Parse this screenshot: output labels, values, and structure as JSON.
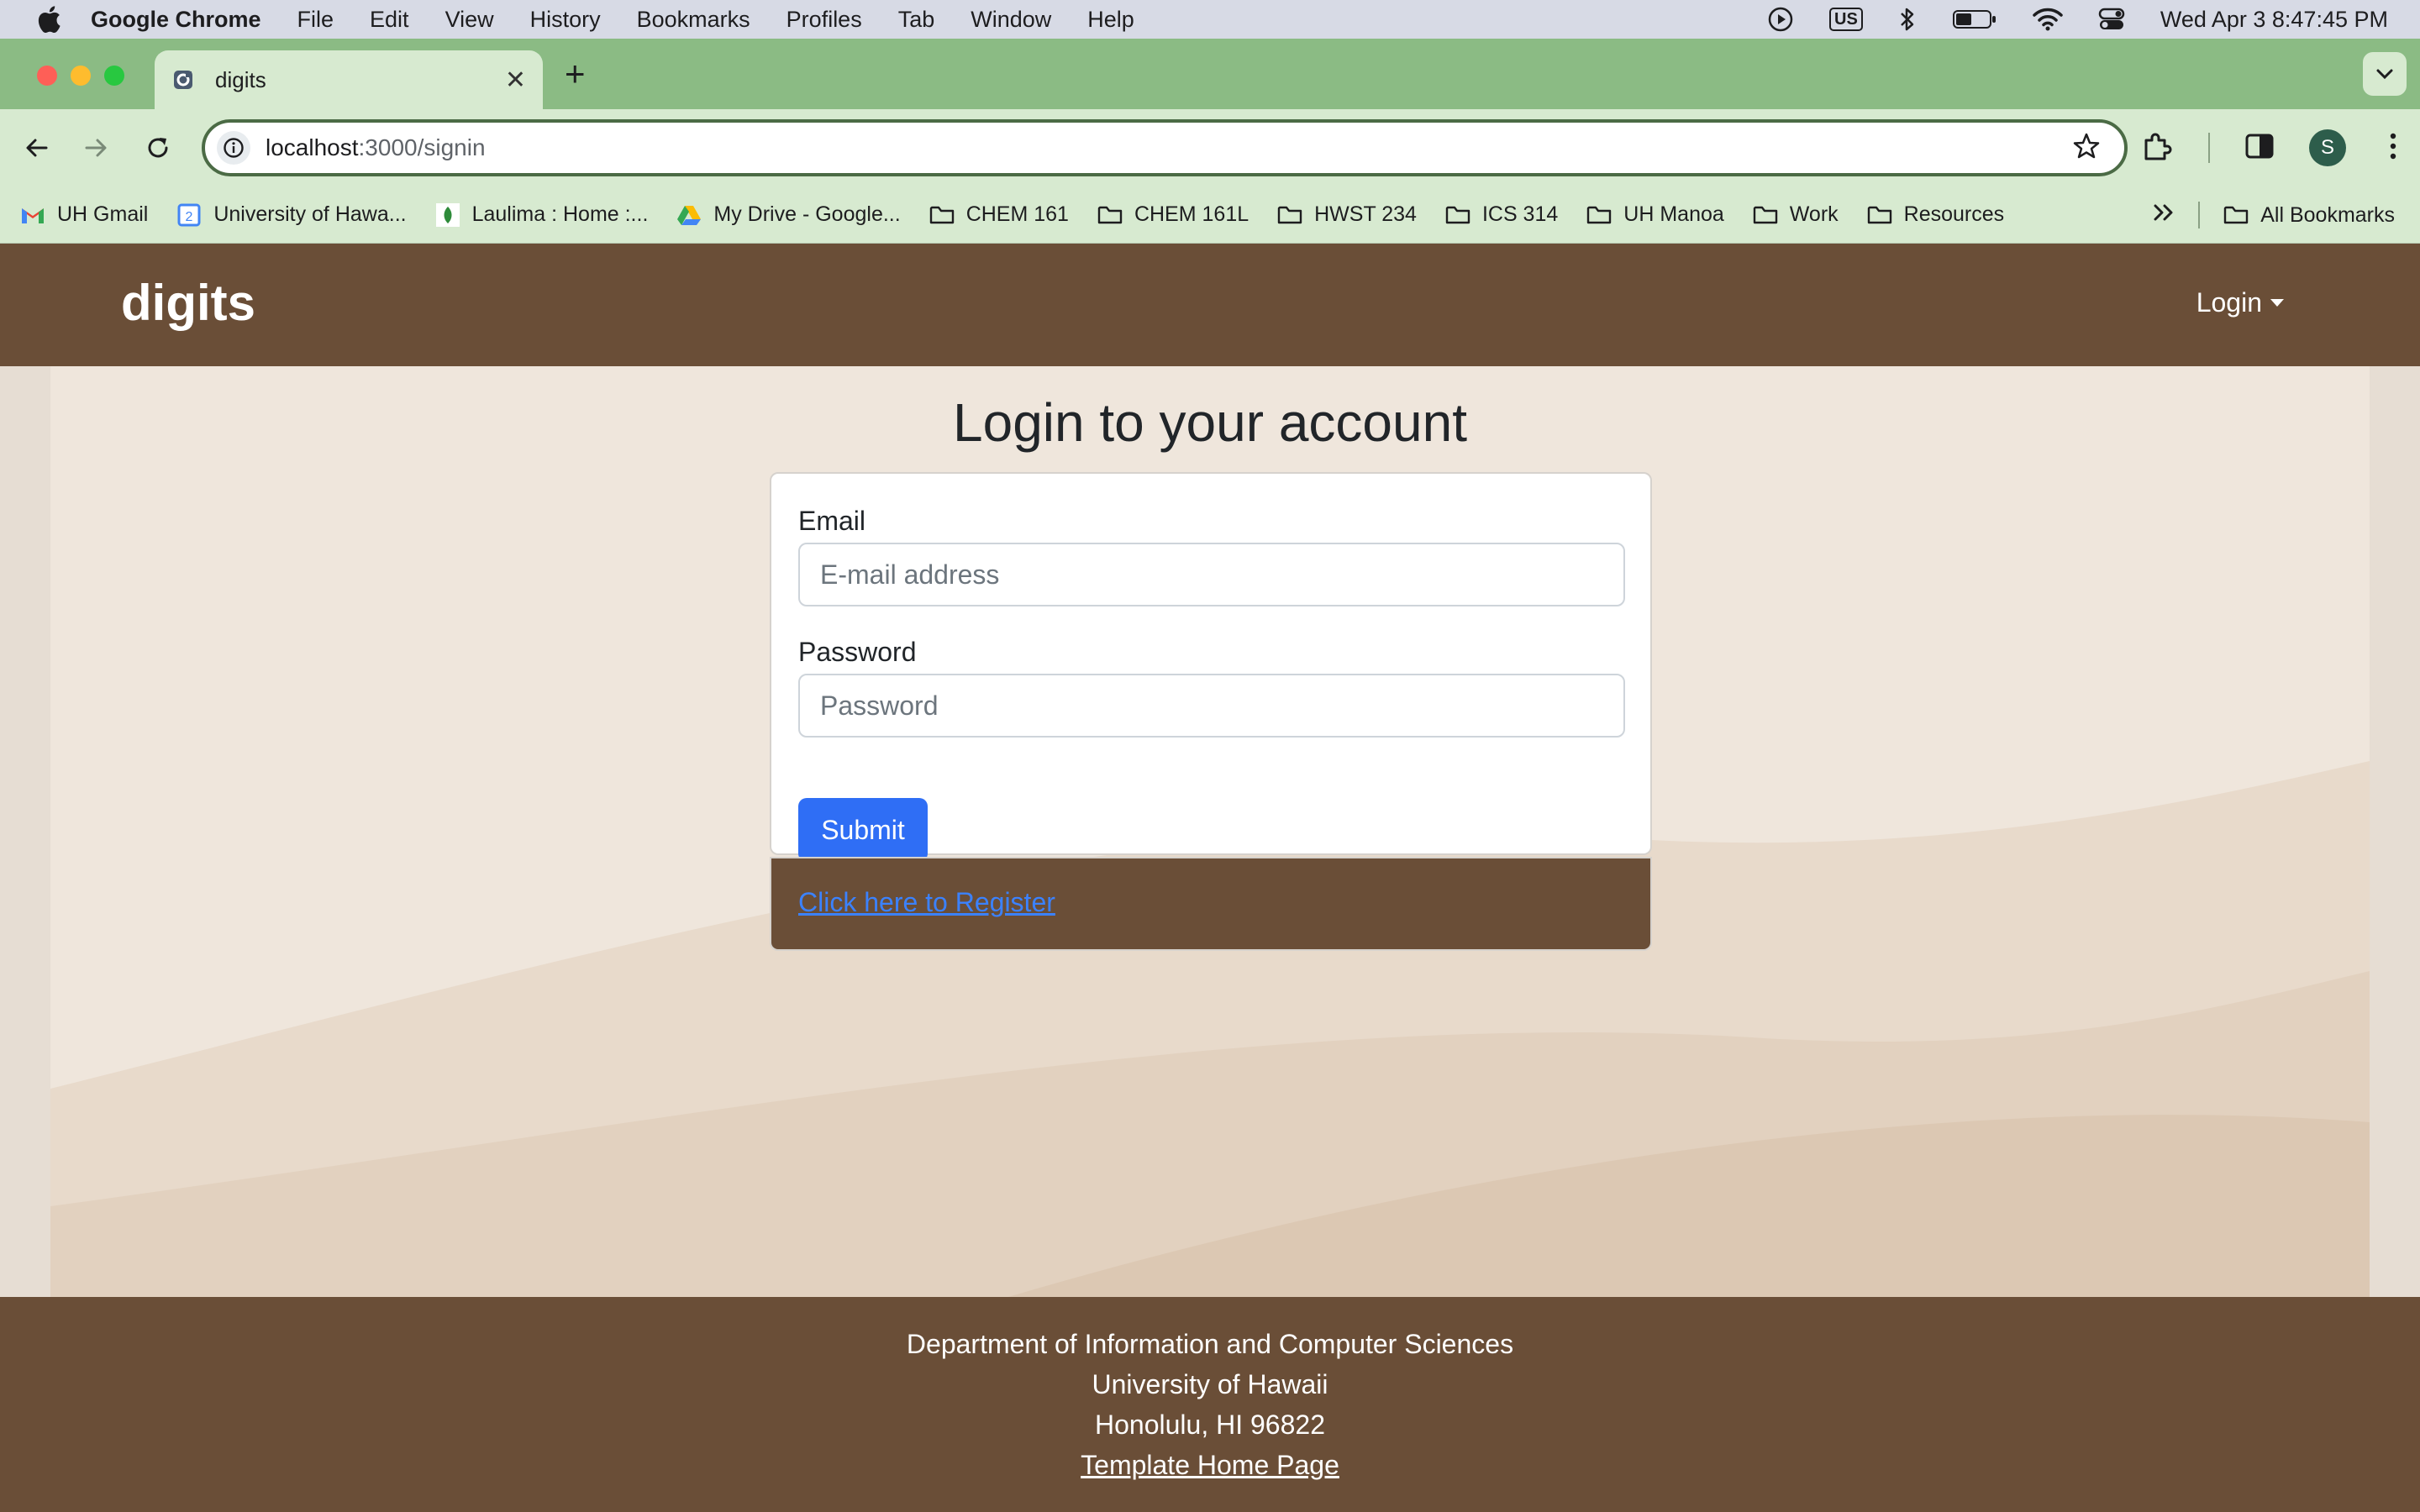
{
  "menubar": {
    "app_name": "Google Chrome",
    "items": [
      "File",
      "Edit",
      "View",
      "History",
      "Bookmarks",
      "Profiles",
      "Tab",
      "Window",
      "Help"
    ],
    "keyboard_layout": "US",
    "clock": "Wed Apr 3  8:47:45 PM"
  },
  "browser": {
    "tab_title": "digits",
    "url_host": "localhost",
    "url_path": ":3000/signin",
    "bookmarks": [
      {
        "label": "UH Gmail",
        "icon": "gmail-icon"
      },
      {
        "label": "University of Hawa...",
        "icon": "calendar-icon"
      },
      {
        "label": "Laulima : Home :...",
        "icon": "laulima-icon"
      },
      {
        "label": "My Drive - Google...",
        "icon": "drive-icon"
      },
      {
        "label": "CHEM 161",
        "icon": "folder-icon"
      },
      {
        "label": "CHEM 161L",
        "icon": "folder-icon"
      },
      {
        "label": "HWST 234",
        "icon": "folder-icon"
      },
      {
        "label": "ICS 314",
        "icon": "folder-icon"
      },
      {
        "label": "UH Manoa",
        "icon": "folder-icon"
      },
      {
        "label": "Work",
        "icon": "folder-icon"
      },
      {
        "label": "Resources",
        "icon": "folder-icon"
      }
    ],
    "all_bookmarks": "All Bookmarks",
    "profile_initial": "S"
  },
  "app": {
    "brand": "digits",
    "login_menu": "Login",
    "heading": "Login to your account",
    "email_label": "Email",
    "email_placeholder": "E-mail address",
    "email_value": "",
    "password_label": "Password",
    "password_placeholder": "Password",
    "password_value": "",
    "submit_label": "Submit",
    "register_link": "Click here to Register",
    "footer": {
      "line1": "Department of Information and Computer Sciences",
      "line2": "University of Hawaii",
      "line3": "Honolulu, HI 96822",
      "link": "Template Home Page"
    }
  },
  "colors": {
    "brand_brown": "#6a4e37",
    "primary_blue": "#2f6ef5",
    "chrome_green": "#8bbb84"
  }
}
